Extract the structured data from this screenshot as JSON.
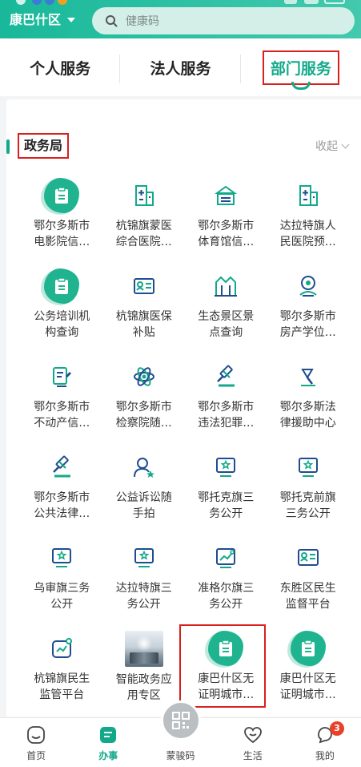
{
  "header": {
    "region": "康巴什区",
    "search_placeholder": "健康码"
  },
  "tabs": [
    {
      "label": "个人服务"
    },
    {
      "label": "法人服务"
    },
    {
      "label": "部门服务"
    }
  ],
  "section": {
    "title": "政务局",
    "collapse_label": "收起"
  },
  "services": [
    {
      "name": "鄂尔多斯市电影院信…",
      "icon": "clipboard-icon"
    },
    {
      "name": "杭锦旗蒙医综合医院…",
      "icon": "hospital-icon"
    },
    {
      "name": "鄂尔多斯市体育馆信…",
      "icon": "stadium-icon"
    },
    {
      "name": "达拉特旗人民医院预…",
      "icon": "hospital-icon"
    },
    {
      "name": "公务培训机构查询",
      "icon": "clipboard-icon"
    },
    {
      "name": "杭锦旗医保补贴",
      "icon": "id-card-icon"
    },
    {
      "name": "生态景区景点查询",
      "icon": "scenic-gate-icon"
    },
    {
      "name": "鄂尔多斯市房产学位…",
      "icon": "house-location-icon"
    },
    {
      "name": "鄂尔多斯市不动产信…",
      "icon": "edit-document-icon"
    },
    {
      "name": "鄂尔多斯市检察院随…",
      "icon": "atom-icon"
    },
    {
      "name": "鄂尔多斯市违法犯罪…",
      "icon": "gavel-icon"
    },
    {
      "name": "鄂尔多斯法律援助中心",
      "icon": "gavel-icon"
    },
    {
      "name": "鄂尔多斯市公共法律…",
      "icon": "gavel-icon"
    },
    {
      "name": "公益诉讼随手拍",
      "icon": "user-star-icon"
    },
    {
      "name": "鄂托克旗三务公开",
      "icon": "monitor-star-icon"
    },
    {
      "name": "鄂托克前旗三务公开",
      "icon": "monitor-star-icon"
    },
    {
      "name": "乌审旗三务公开",
      "icon": "monitor-star-icon"
    },
    {
      "name": "达拉特旗三务公开",
      "icon": "monitor-star-icon"
    },
    {
      "name": "准格尔旗三务公开",
      "icon": "chart-monitor-icon"
    },
    {
      "name": "东胜区民生监督平台",
      "icon": "id-card-icon"
    },
    {
      "name": "杭锦旗民生监管平台",
      "icon": "chart-monitor-icon"
    },
    {
      "name": "智能政务应用专区",
      "icon": "photo-thumbnail"
    },
    {
      "name": "康巴什区无证明城市…",
      "icon": "clipboard-icon"
    },
    {
      "name": "康巴什区无证明城市…",
      "icon": "clipboard-icon"
    }
  ],
  "bottom_nav": [
    {
      "label": "首页"
    },
    {
      "label": "办事"
    },
    {
      "label": "蒙骏码"
    },
    {
      "label": "生活"
    },
    {
      "label": "我的",
      "badge": "3"
    }
  ],
  "colors": {
    "brand": "#12a98a",
    "highlight_border": "#d9201e",
    "badge": "#e8412b"
  }
}
